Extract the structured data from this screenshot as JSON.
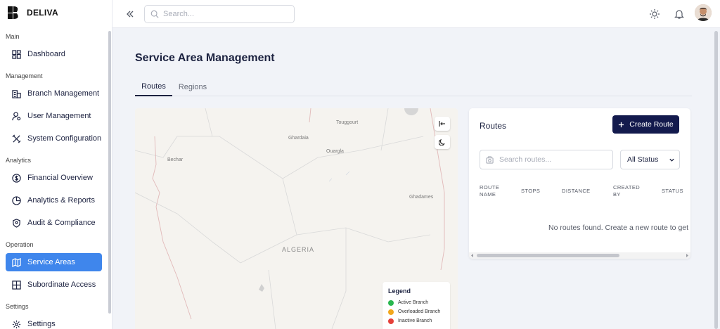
{
  "brand": {
    "name": "DELIVA"
  },
  "sidebar": {
    "sections": [
      {
        "label": "Main"
      },
      {
        "label": "Management"
      },
      {
        "label": "Analytics"
      },
      {
        "label": "Operation"
      },
      {
        "label": "Settings"
      }
    ],
    "items": [
      {
        "label": "Dashboard",
        "icon": "dashboard-grid-icon"
      },
      {
        "label": "Branch Management",
        "icon": "building-icon"
      },
      {
        "label": "User Management",
        "icon": "user-gear-icon"
      },
      {
        "label": "System Configuration",
        "icon": "tools-icon"
      },
      {
        "label": "Financial Overview",
        "icon": "dollar-circle-icon"
      },
      {
        "label": "Analytics & Reports",
        "icon": "pie-chart-icon"
      },
      {
        "label": "Audit & Compliance",
        "icon": "shield-icon"
      },
      {
        "label": "Service Areas",
        "icon": "map-icon",
        "active": true
      },
      {
        "label": "Subordinate Access",
        "icon": "table-grid-icon"
      },
      {
        "label": "Settings",
        "icon": "gear-icon"
      }
    ]
  },
  "topbar": {
    "search_placeholder": "Search..."
  },
  "main": {
    "title": "Service Area Management",
    "tabs": [
      {
        "label": "Routes",
        "active": true
      },
      {
        "label": "Regions"
      }
    ]
  },
  "map": {
    "places": [
      "Touggourt",
      "Ghardaia",
      "Ouargla",
      "Bechar",
      "Ghadames"
    ],
    "country": "ALGERIA",
    "legend": {
      "title": "Legend",
      "items": [
        {
          "label": "Active Branch",
          "color": "#2ab74f"
        },
        {
          "label": "Overloaded Branch",
          "color": "#f2a81d"
        },
        {
          "label": "Inactive Branch",
          "color": "#e5403a"
        }
      ]
    }
  },
  "routes": {
    "title": "Routes",
    "create_label": "Create Route",
    "search_placeholder": "Search routes...",
    "status_filter": "All Status",
    "columns": [
      "ROUTE NAME",
      "STOPS",
      "DISTANCE",
      "CREATED BY",
      "STATUS"
    ],
    "empty_message": "No routes found. Create a new route to get s"
  },
  "colors": {
    "accent": "#3f86ec",
    "primary_dark": "#131a4d"
  }
}
